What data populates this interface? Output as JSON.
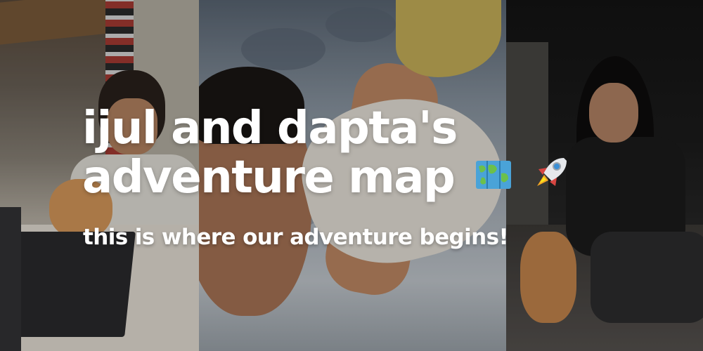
{
  "hero": {
    "title_line1": "ijul and dapta's",
    "title_line2": "adventure map",
    "title_emojis": [
      "map-icon",
      "rocket-icon"
    ],
    "subtitle": "this is where our adventure begins!",
    "text_color": "#ffffff"
  }
}
